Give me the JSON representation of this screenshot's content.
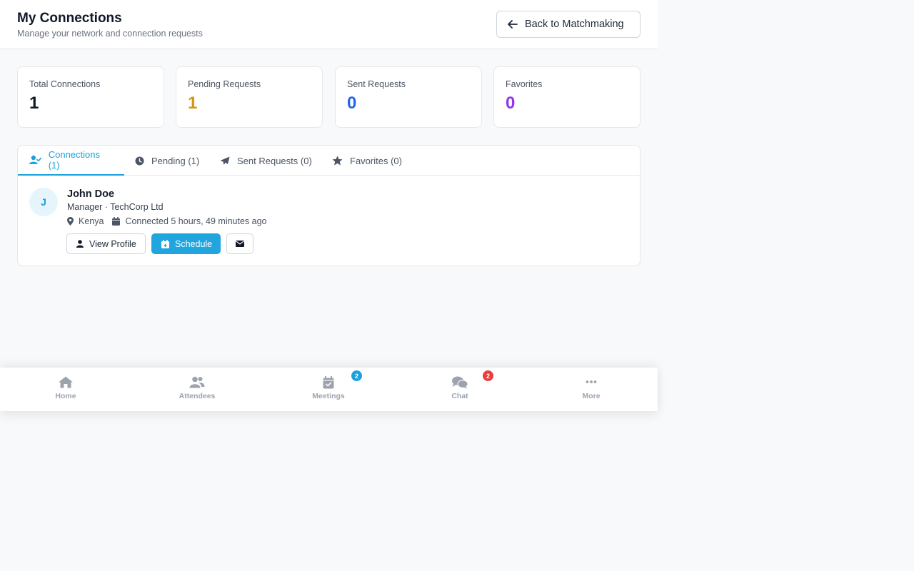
{
  "header": {
    "title": "My Connections",
    "subtitle": "Manage your network and connection requests",
    "back_label": "Back to Matchmaking"
  },
  "stats": [
    {
      "label": "Total Connections",
      "value": "1",
      "color": "#111827"
    },
    {
      "label": "Pending Requests",
      "value": "1",
      "color": "#d4960f"
    },
    {
      "label": "Sent Requests",
      "value": "0",
      "color": "#2563eb"
    },
    {
      "label": "Favorites",
      "value": "0",
      "color": "#9333ea"
    }
  ],
  "tabs": [
    {
      "label": "Connections (1)",
      "icon": "user-check-icon",
      "active": true
    },
    {
      "label": "Pending (1)",
      "icon": "clock-icon",
      "active": false
    },
    {
      "label": "Sent Requests (0)",
      "icon": "paper-plane-icon",
      "active": false
    },
    {
      "label": "Favorites (0)",
      "icon": "star-icon",
      "active": false
    }
  ],
  "connection": {
    "initial": "J",
    "name": "John Doe",
    "role": "Manager · TechCorp Ltd",
    "location": "Kenya",
    "connected": "Connected 5 hours, 49 minutes ago",
    "view_profile_label": "View Profile",
    "schedule_label": "Schedule"
  },
  "bottom_nav": [
    {
      "label": "Home",
      "icon": "home-icon"
    },
    {
      "label": "Attendees",
      "icon": "users-icon"
    },
    {
      "label": "Meetings",
      "icon": "calendar-check-icon",
      "badge": "2",
      "badge_color": "#1aa0dc"
    },
    {
      "label": "Chat",
      "icon": "chat-icon",
      "badge": "2",
      "badge_color": "#e53e3e"
    },
    {
      "label": "More",
      "icon": "more-dots-icon"
    }
  ],
  "colors": {
    "accent": "#1aa0dc",
    "primary_button": "#21a5de"
  }
}
